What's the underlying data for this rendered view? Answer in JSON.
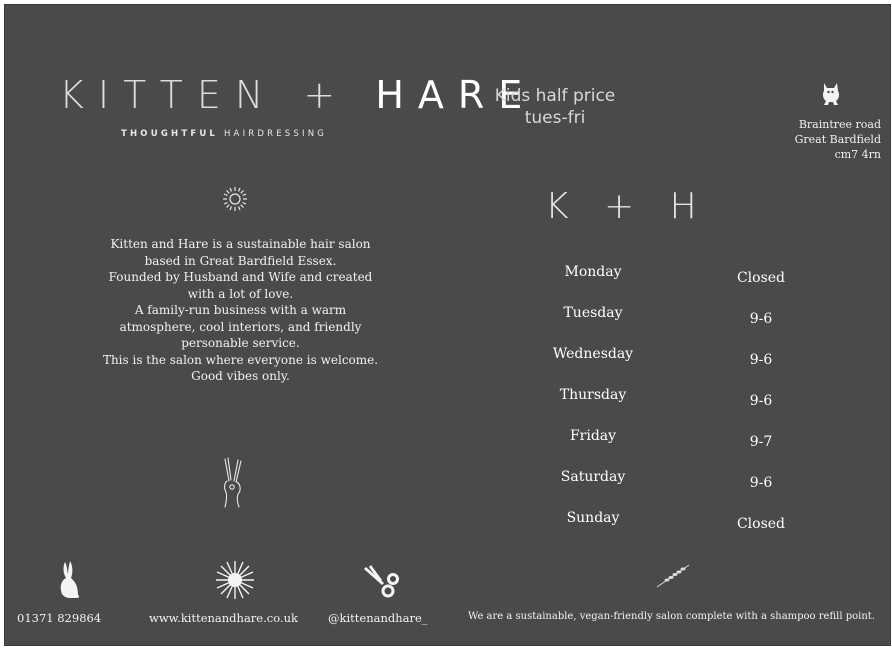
{
  "brand": {
    "logo_left": "KITTEN + ",
    "logo_right": "HARE",
    "tagline_bold": "THOUGHTFUL",
    "tagline_rest": " HAIRDRESSING"
  },
  "promo": {
    "line1": "Kids half price",
    "line2": "tues-fri"
  },
  "address": {
    "line1": "Braintree road",
    "line2": "Great Bardfield",
    "line3": "cm7 4rn"
  },
  "short_logo": "K + H",
  "about": [
    "Kitten and Hare is a sustainable hair salon",
    "based in Great Bardfield Essex.",
    "Founded by Husband and Wife and created",
    "with a lot of love.",
    "A family-run business with a warm",
    "atmosphere, cool interiors, and friendly",
    "personable service.",
    "This is the salon where everyone is welcome.",
    "Good vibes only."
  ],
  "hours": [
    {
      "day": "Monday",
      "time": "Closed"
    },
    {
      "day": "Tuesday",
      "time": "9-6"
    },
    {
      "day": "Wednesday",
      "time": "9-6"
    },
    {
      "day": "Thursday",
      "time": "9-6"
    },
    {
      "day": "Friday",
      "time": "9-7"
    },
    {
      "day": "Saturday",
      "time": "9-6"
    },
    {
      "day": "Sunday",
      "time": "Closed"
    }
  ],
  "footer": {
    "phone": "01371 829864",
    "website": "www.kittenandhare.co.uk",
    "instagram": "@kittenandhare_",
    "note": "We are a sustainable, vegan-friendly salon complete with a shampoo refill point."
  },
  "icons": [
    "cat-icon",
    "sun-icon",
    "peace-hand-icon",
    "rabbit-icon",
    "starburst-icon",
    "scissors-icon",
    "lavender-icon"
  ],
  "colors": {
    "background": "#4a4a4a",
    "text": "#ffffff"
  }
}
